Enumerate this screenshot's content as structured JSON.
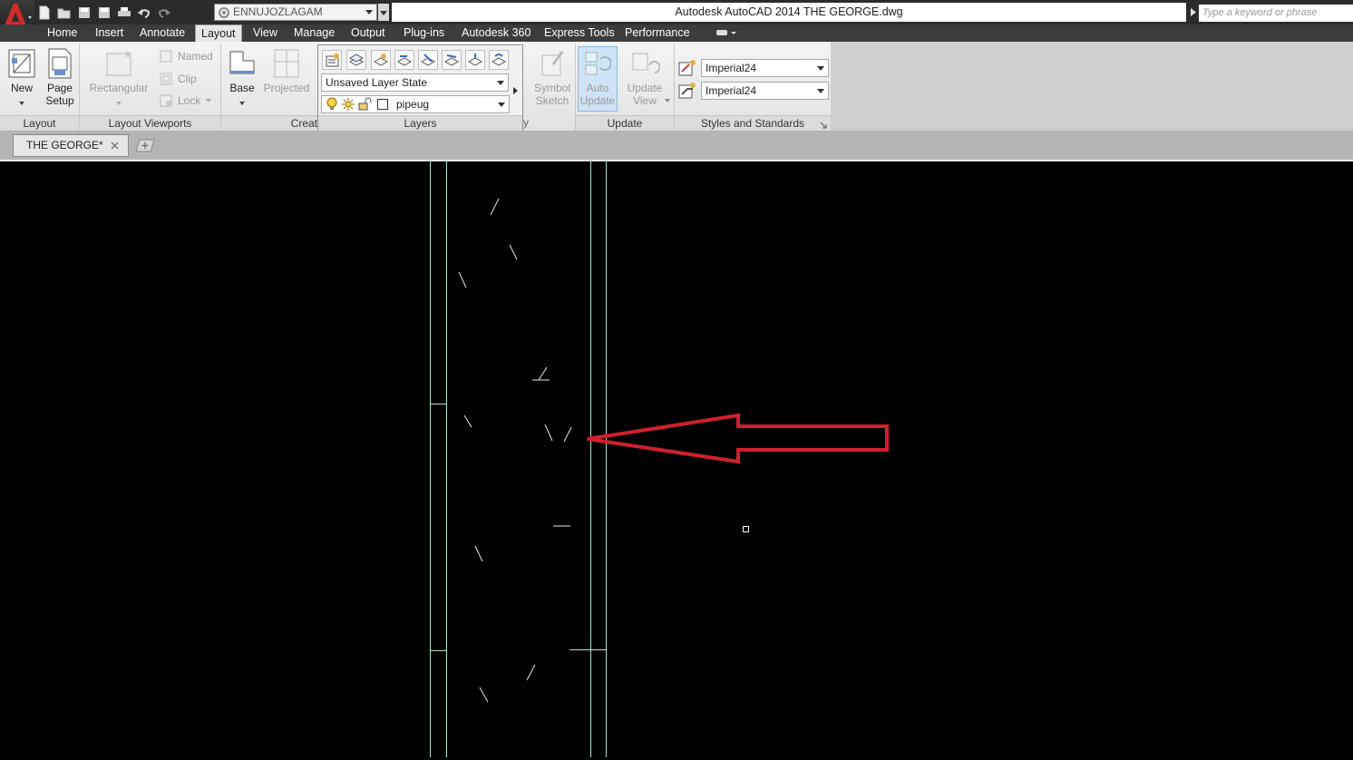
{
  "title_bar": {
    "app_title": "Autodesk AutoCAD 2014    THE GEORGE.dwg",
    "workspace_value": "ENNUJOZLAGAM",
    "search_placeholder": "Type a keyword or phrase"
  },
  "ribbon_tabs": [
    "Home",
    "Insert",
    "Annotate",
    "Layout",
    "View",
    "Manage",
    "Output",
    "Plug-ins",
    "Autodesk 360",
    "Express Tools",
    "Performance"
  ],
  "active_tab": "Layout",
  "panels": {
    "layout": {
      "title": "Layout",
      "new_label": "New",
      "page_setup_label_1": "Page",
      "page_setup_label_2": "Setup"
    },
    "viewports": {
      "title": "Layout Viewports",
      "rectangular": "Rectangular",
      "named": "Named",
      "clip": "Clip",
      "lock": "Lock"
    },
    "create": {
      "title": "Creat",
      "base": "Base",
      "projected": "Projected"
    },
    "layers": {
      "title": "Layers",
      "layer_state": "Unsaved Layer State",
      "current_layer": "pipeug"
    },
    "modify_title_fragment": "y",
    "symbol": {
      "label_1": "Symbol",
      "label_2": "Sketch"
    },
    "update": {
      "title": "Update",
      "auto_1": "Auto",
      "auto_2": "Update",
      "view_1": "Update",
      "view_2": "View"
    },
    "styles": {
      "title": "Styles and Standards",
      "style_1": "Imperial24",
      "style_2": "Imperial24"
    }
  },
  "document_tab": {
    "label": "THE GEORGE*"
  },
  "colors": {
    "accent_red": "#d42a2a",
    "canvas_bg": "#000000",
    "line_green": "#b4e2c2",
    "arrow_red": "#d0202b"
  }
}
